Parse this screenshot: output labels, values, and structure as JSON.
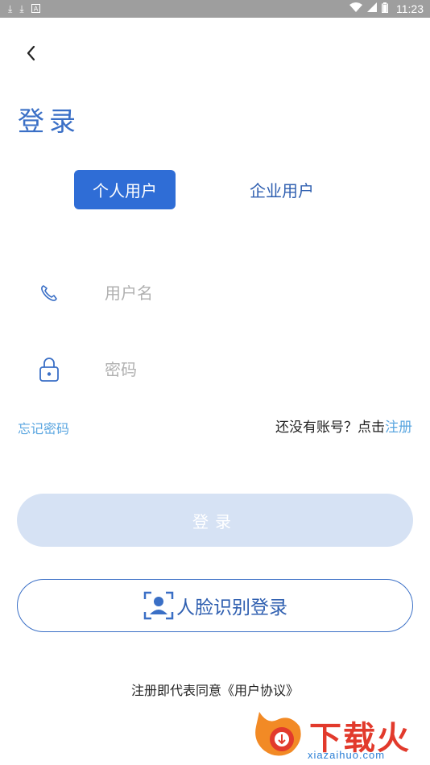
{
  "status_bar": {
    "time": "11:23",
    "left_icons": [
      "download-icon",
      "download-icon",
      "notification-icon"
    ],
    "right_icons": [
      "wifi-icon",
      "signal-icon",
      "battery-icon"
    ]
  },
  "header": {
    "title": "登录"
  },
  "tabs": [
    {
      "label": "个人用户",
      "selected": true
    },
    {
      "label": "企业用户",
      "selected": false
    }
  ],
  "form": {
    "username_placeholder": "用户名",
    "username_value": "",
    "password_placeholder": "密码",
    "password_value": ""
  },
  "links": {
    "forgot_password": "忘记密码",
    "no_account_prompt": "还没有账号？点击",
    "register": "注册"
  },
  "buttons": {
    "login": "登录",
    "face_login": "人脸识别登录"
  },
  "footer": {
    "agreement": "注册即代表同意《用户协议》"
  },
  "watermark": {
    "brand": "下载火",
    "domain": "xiazaihuo.com"
  },
  "colors": {
    "primary": "#2f6dd6",
    "link": "#5aa6e0",
    "login_disabled": "#d6e2f4",
    "status_bar": "#9e9e9e"
  }
}
